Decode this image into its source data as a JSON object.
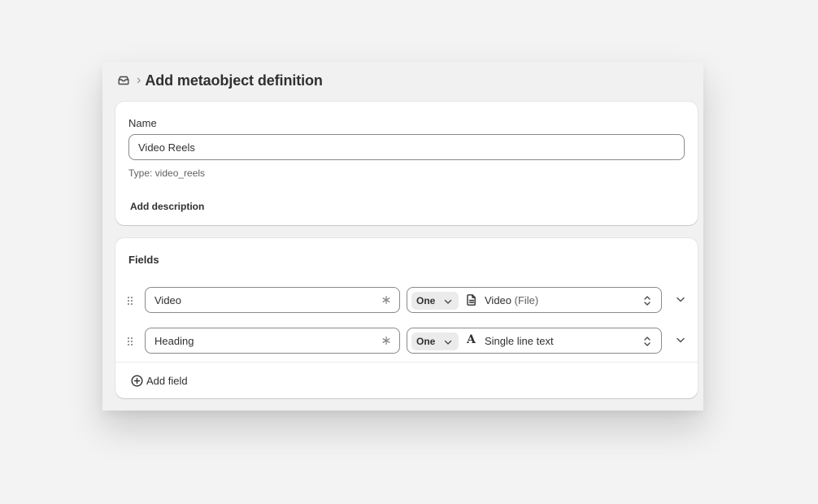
{
  "header": {
    "icon": "metaobject-icon",
    "separator": "›",
    "title": "Add metaobject definition"
  },
  "name_card": {
    "label": "Name",
    "value": "Video Reels",
    "type_text": "Type: video_reels",
    "add_description": "Add description"
  },
  "fields_card": {
    "title": "Fields",
    "rows": [
      {
        "name": "Video",
        "required_icon": "asterisk-icon",
        "cardinality": "One",
        "type_icon": "file-icon",
        "type_label": "Video",
        "type_sub": "(File)"
      },
      {
        "name": "Heading",
        "required_icon": "asterisk-icon",
        "cardinality": "One",
        "type_icon": "text-icon",
        "type_glyph": "A",
        "type_label": "Single line text",
        "type_sub": ""
      }
    ],
    "add_field": "Add field"
  }
}
